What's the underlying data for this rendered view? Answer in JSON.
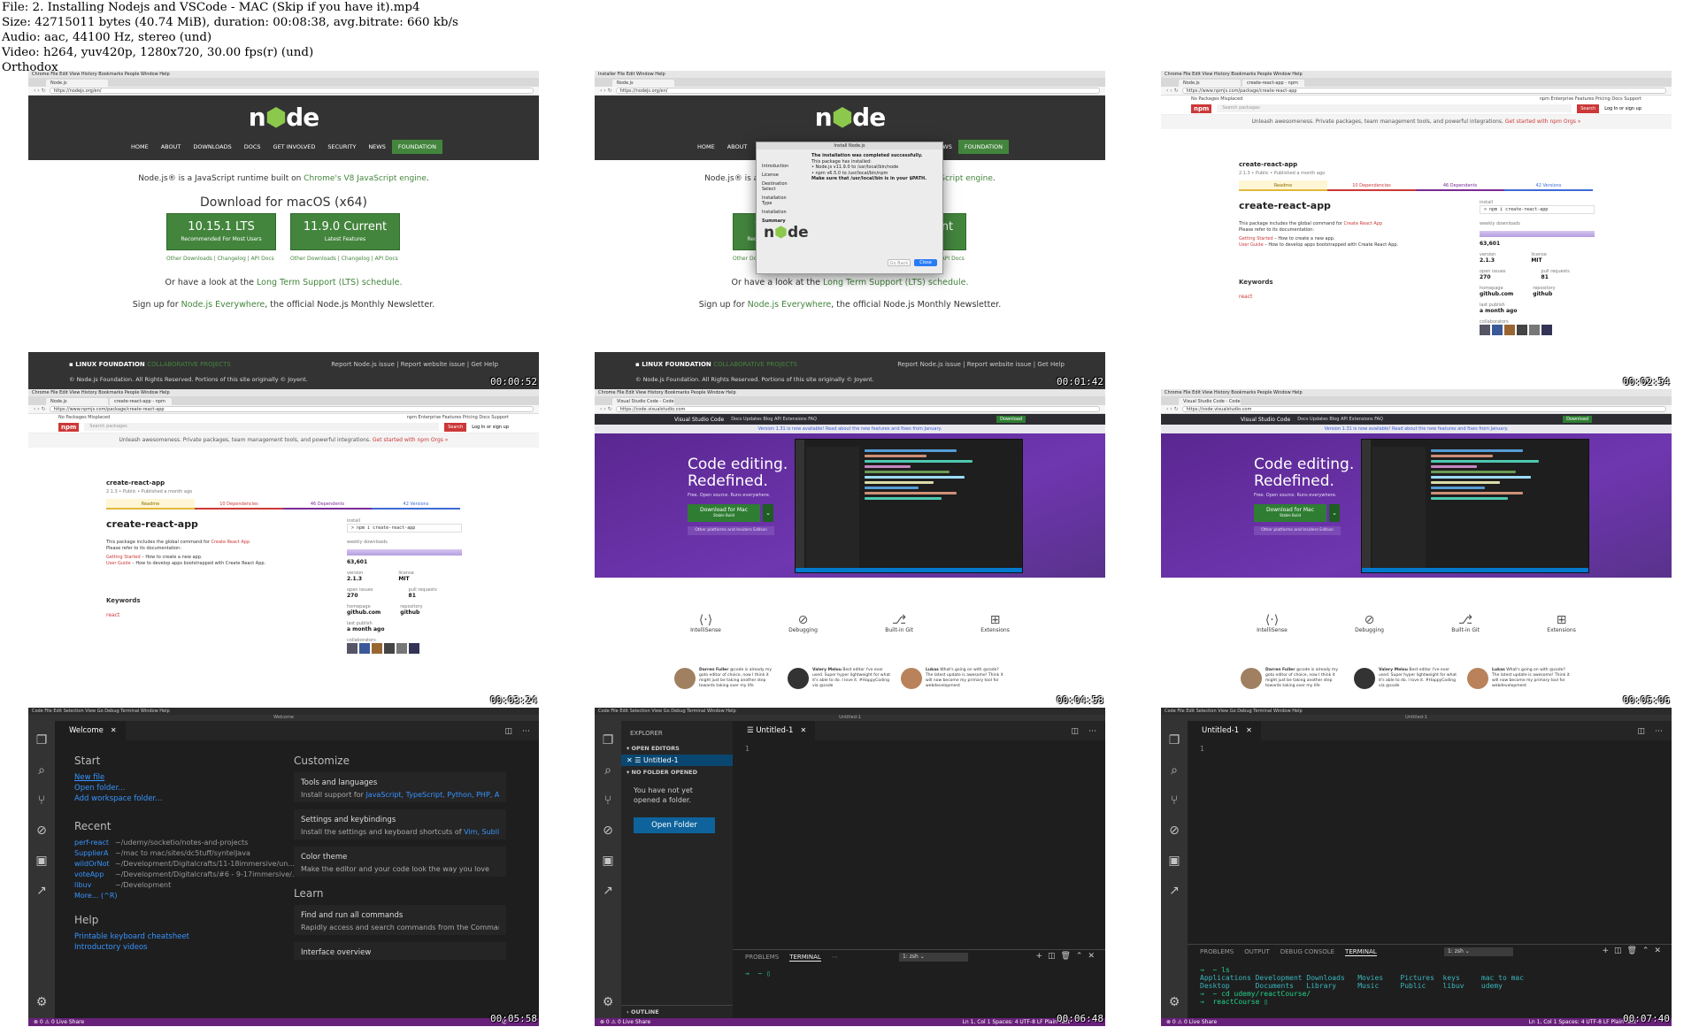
{
  "meta": {
    "lines": [
      "File: 2. Installing Nodejs and VSCode - MAC (Skip if you have it).mp4",
      "Size: 42715011 bytes (40.74 MiB), duration: 00:08:38, avg.bitrate: 660 kb/s",
      "Audio: aac, 44100 Hz, stereo (und)",
      "Video: h264, yuv420p, 1280x720, 30.00 fps(r) (und)",
      "Orthodox"
    ]
  },
  "timestamps": [
    "00:00:52",
    "00:01:42",
    "00:02:54",
    "00:03:24",
    "00:04:58",
    "00:05:06",
    "00:05:58",
    "00:06:48",
    "00:07:40"
  ],
  "chrome": {
    "mac_menu": "Chrome  File  Edit  View  History  Bookmarks  People  Window  Help",
    "mac_menu_installer": "Installer  File  Edit  Window  Help",
    "mac_menu_code": "Code  File  Edit  Selection  View  Go  Debug  Terminal  Window  Help",
    "tab_node": "Node.js",
    "tab_npm": "create-react-app - npm",
    "tab_vscode": "Visual Studio Code - Code Edi",
    "url_node": "https://nodejs.org/en/",
    "url_npm": "https://www.npmjs.com/package/create-react-app",
    "url_vscode": "https://code.visualstudio.com"
  },
  "node": {
    "nav": [
      "HOME",
      "ABOUT",
      "DOWNLOADS",
      "DOCS",
      "GET INVOLVED",
      "SECURITY",
      "NEWS",
      "FOUNDATION"
    ],
    "intro_pre": "Node.js® is a JavaScript runtime built on ",
    "intro_link": "Chrome's V8 JavaScript engine",
    "intro_post": ".",
    "download_title": "Download for macOS (x64)",
    "lts_version": "10.15.1 LTS",
    "lts_sub": "Recommended For Most Users",
    "current_version": "11.9.0 Current",
    "current_sub": "Latest Features",
    "links_a": "Other Downloads | Changelog | API Docs",
    "links_b": "Other Downloads | Changelog | API Docs",
    "lts_pre": "Or have a look at the ",
    "lts_link": "Long Term Support (LTS) schedule.",
    "news_pre": "Sign up for ",
    "news_link": "Node.js Everywhere",
    "news_post": ", the official Node.js Monthly Newsletter.",
    "footer_lf": "LINUX FOUNDATION",
    "footer_collab": "COLLABORATIVE PROJECTS",
    "footer_links": "Report Node.js issue | Report website issue | Get Help",
    "footer_copy": "© Node.js Foundation. All Rights Reserved. Portions of this site originally © Joyent."
  },
  "installer": {
    "title": "Install Node.js",
    "steps": [
      "Introduction",
      "License",
      "Destination Select",
      "Installation Type",
      "Installation",
      "Summary"
    ],
    "success": "The installation was completed successfully.",
    "installed": "This package has installed:",
    "item1": "• Node.js v11.9.0 to /usr/local/bin/node",
    "item2": "• npm v6.5.0 to /usr/local/bin/npm",
    "path_note": "Make sure that /usr/local/bin is in your $PATH.",
    "back": "Go Back",
    "close": "Close"
  },
  "npm": {
    "top_left": "No Packages Misplaced",
    "top_right": "npm Enterprise   Features   Pricing   Docs   Support",
    "logo": "npm",
    "search_placeholder": "Search packages",
    "search_btn": "Search",
    "signin": "Log In   or   sign up",
    "banner_pre": "Unleash awesomeness.  Private packages, team management tools, and powerful integrations. ",
    "banner_link": "Get started with npm Orgs »",
    "pkg_name": "create-react-app",
    "pkg_meta": "2.1.3 • Public • Published a month ago",
    "tabs": [
      "Readme",
      "10 Dependencies",
      "46 Dependents",
      "42 Versions"
    ],
    "title": "create-react-app",
    "desc1_pre": "This package includes the global command for ",
    "desc1_link": "Create React App",
    "desc2": "Please refer to its documentation:",
    "li1_link": "Getting Started",
    "li1": " – How to create a new app.",
    "li2_link": "User Guide",
    "li2": " – How to develop apps bootstrapped with Create React App.",
    "keywords": "Keywords",
    "keyword": "react",
    "install_lbl": "install",
    "install_cmd": "> npm i create-react-app",
    "weekly_lbl": "weekly downloads",
    "weekly": "63,601",
    "version_lbl": "version",
    "version": "2.1.3",
    "license_lbl": "license",
    "license": "MIT",
    "issues_lbl": "open issues",
    "issues": "270",
    "prs_lbl": "pull requests",
    "prs": "81",
    "home_lbl": "homepage",
    "home": "github.com",
    "repo_lbl": "repository",
    "repo": "github",
    "last_lbl": "last publish",
    "last": "a month ago",
    "collab_lbl": "collaborators"
  },
  "vscode_site": {
    "brand": "Visual Studio Code",
    "nav": "Docs   Updates   Blog   API   Extensions   FAQ",
    "search": "Search Docs",
    "download": "Download",
    "note": "Version 1.31 is now available! Read about the new features and fixes from January.",
    "h1a": "Code editing.",
    "h1b": "Redefined.",
    "sub": "Free. Open source. Runs everywhere.",
    "dl": "Download for Mac",
    "dl_sub": "Stable Build",
    "other": "Other platforms and Insiders Edition",
    "features": [
      "IntelliSense",
      "Debugging",
      "Built-in Git",
      "Extensions"
    ],
    "quotes": [
      {
        "name": "Darren Fuller",
        "text": "@code is already my goto editor of choice, now I think it might just be taking another step towards taking over my life"
      },
      {
        "name": "Valery Melou",
        "text": "Best editor I've ever used. Super hyper lightweight for what it's able to do. I love it. #HappyCoding via @code"
      },
      {
        "name": "Lukas",
        "text": "What's going on with @code? The latest update is awesome! Think it will now become my primary tool for webdevelopment"
      }
    ]
  },
  "code": {
    "welcome_tab": "Welcome",
    "untitled_tab": "Untitled-1",
    "start": "Start",
    "start_links": [
      "New file",
      "Open folder...",
      "Add workspace folder..."
    ],
    "recent": "Recent",
    "recent_items": [
      {
        "name": "perf-react",
        "path": "~/udemy/socketio/notes-and-projects"
      },
      {
        "name": "SupplierA",
        "path": "~/mac to mac/sites/dc5tuff/syntelJava"
      },
      {
        "name": "wildOrNot",
        "path": "~/Development/Digitalcrafts/11-18immersive/un..."
      },
      {
        "name": "voteApp",
        "path": "~/Development/Digitalcrafts/#6 - 9-17immersive/..."
      },
      {
        "name": "libuv",
        "path": "~/Development"
      }
    ],
    "more": "More...  (^R)",
    "help": "Help",
    "help_links": [
      "Printable keyboard cheatsheet",
      "Introductory videos"
    ],
    "customize": "Customize",
    "cards": [
      {
        "title": "Tools and languages",
        "pre": "Install support for ",
        "links": "JavaScript, TypeScript, Python, PHP, A..."
      },
      {
        "title": "Settings and keybindings",
        "pre": "Install the settings and keyboard shortcuts of ",
        "links": "Vim, Sublim..."
      },
      {
        "title": "Color theme",
        "pre": "Make the editor and your code look the way you love",
        "links": ""
      }
    ],
    "learn": "Learn",
    "learn_cards": [
      {
        "title": "Find and run all commands",
        "desc": "Rapidly access and search commands from the Comman..."
      },
      {
        "title": "Interface overview",
        "desc": ""
      }
    ],
    "explorer": "EXPLORER",
    "open_editors": "OPEN EDITORS",
    "no_folder": "NO FOLDER OPENED",
    "no_folder_msg": "You have not yet opened a folder.",
    "open_folder": "Open Folder",
    "outline": "OUTLINE",
    "line1": "1",
    "panel_tabs_b": [
      "PROBLEMS",
      "TERMINAL"
    ],
    "panel_tabs_c": [
      "PROBLEMS",
      "OUTPUT",
      "DEBUG CONSOLE",
      "TERMINAL"
    ],
    "shell": "1: zsh",
    "term_prompt_b": "→  ~ ▯",
    "term_lines": [
      "→  ~ ls",
      "Applications Development Downloads   Movies    Pictures  keys     mac to mac",
      "Desktop      Documents   Library     Music     Public    libuv    udemy",
      "→  ~ cd udemy/reactCourse/",
      "→  reactCourse ▯"
    ],
    "status_left": "⊗ 0 ⚠ 0   Live Share",
    "status_right_b": "Ln 1, Col 1   Spaces: 4   UTF-8   LF   Plain Text",
    "status_right_c": "Ln 1, Col 1   Spaces: 4   UTF-8   LF   Plain Text",
    "window_title": "Welcome"
  },
  "colors": {
    "node_green": "#43853d",
    "npm_red": "#cb3837",
    "vs_purple": "#68217a",
    "vs_blue": "#3794ff"
  }
}
